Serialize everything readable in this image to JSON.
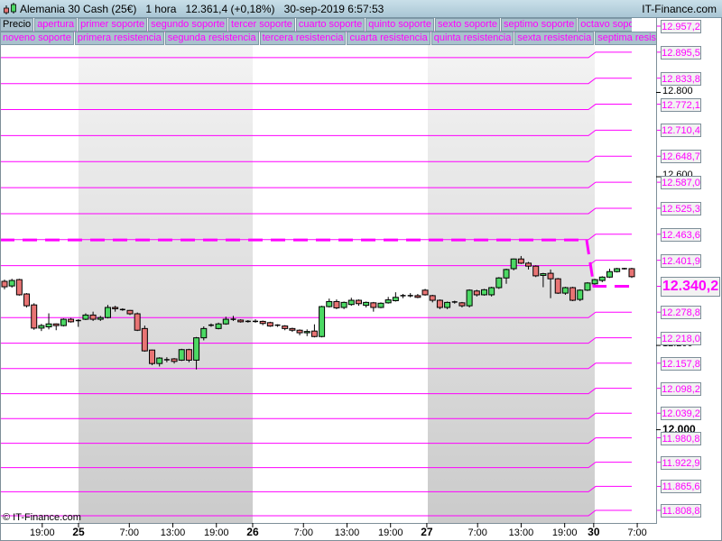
{
  "header": {
    "instrument": "Alemania 30 Cash (25€)",
    "timeframe": "1 hora",
    "price": "12.361,4 (+0,18%)",
    "datetime": "30-sep-2019 6:57:53",
    "brand": "IT-Finance.com"
  },
  "legend_row1": [
    "Precio",
    "apertura",
    "primer soporte",
    "segundo soporte",
    "tercer soporte",
    "cuarto soporte",
    "quinto soporte",
    "sexto soporte",
    "septimo soporte",
    "octavo soporte"
  ],
  "legend_row2": [
    "noveno soporte",
    "primera resistencia",
    "segunda resistencia",
    "tercera resistencia",
    "cuarta resistencia",
    "quinta resistencia",
    "sexta resistencia",
    "septima resistencia"
  ],
  "colors": {
    "level": "#ff00ff",
    "up": "#4cd964",
    "down": "#e87474",
    "axis": "#7e8f99"
  },
  "current_price": {
    "value": 12340.2,
    "label": "12.340,2",
    "previous": 12450
  },
  "levels": [
    {
      "value": 12957.2,
      "label": "12.957,2"
    },
    {
      "value": 12895.5,
      "label": "12.895,5"
    },
    {
      "value": 12833.8,
      "label": "12.833,8"
    },
    {
      "value": 12772.1,
      "label": "12.772,1"
    },
    {
      "value": 12710.4,
      "label": "12.710,4"
    },
    {
      "value": 12648.7,
      "label": "12.648,7"
    },
    {
      "value": 12587.0,
      "label": "12.587,0"
    },
    {
      "value": 12525.3,
      "label": "12.525,3"
    },
    {
      "value": 12463.6,
      "label": "12.463,6"
    },
    {
      "value": 12401.9,
      "label": "12.401,9"
    },
    {
      "value": 12278.8,
      "label": "12.278,8"
    },
    {
      "value": 12218.0,
      "label": "12.218,0"
    },
    {
      "value": 12157.8,
      "label": "12.157,8"
    },
    {
      "value": 12098.2,
      "label": "12.098,2"
    },
    {
      "value": 12039.2,
      "label": "12.039,2"
    },
    {
      "value": 11980.8,
      "label": "11.980,8"
    },
    {
      "value": 11922.9,
      "label": "11.922,9"
    },
    {
      "value": 11865.6,
      "label": "11.865,6"
    },
    {
      "value": 11808.8,
      "label": "11.808,8"
    }
  ],
  "y_axis_ticks": [
    {
      "value": 12800,
      "label": "12.800",
      "bold": false
    },
    {
      "value": 12600,
      "label": "12.600",
      "bold": false
    },
    {
      "value": 12200,
      "label": "12.200",
      "bold": false
    },
    {
      "value": 12000,
      "label": "12.000",
      "bold": true
    }
  ],
  "x_axis_ticks": [
    {
      "hour": -5,
      "label": "19:00",
      "bold": false
    },
    {
      "hour": 0,
      "label": "25",
      "bold": true
    },
    {
      "hour": 7,
      "label": "7:00",
      "bold": false
    },
    {
      "hour": 13,
      "label": "13:00",
      "bold": false
    },
    {
      "hour": 19,
      "label": "19:00",
      "bold": false
    },
    {
      "hour": 24,
      "label": "26",
      "bold": true
    },
    {
      "hour": 31,
      "label": "7:00",
      "bold": false
    },
    {
      "hour": 37,
      "label": "13:00",
      "bold": false
    },
    {
      "hour": 43,
      "label": "19:00",
      "bold": false
    },
    {
      "hour": 48,
      "label": "27",
      "bold": true
    },
    {
      "hour": 55,
      "label": "7:00",
      "bold": false
    },
    {
      "hour": 61,
      "label": "13:00",
      "bold": false
    },
    {
      "hour": 67,
      "label": "19:00",
      "bold": false
    },
    {
      "hour": 71,
      "label": "30",
      "bold": true
    },
    {
      "hour": 77,
      "label": "7:00",
      "bold": false
    }
  ],
  "copyright": "© IT-Finance.com",
  "candles": [
    [
      12352,
      12356,
      12333,
      12339
    ],
    [
      12341,
      12358,
      12337,
      12354
    ],
    [
      12356,
      12358,
      12318,
      12320
    ],
    [
      12322,
      12324,
      12290,
      12294
    ],
    [
      12296,
      12300,
      12237,
      12241
    ],
    [
      12241,
      12251,
      12234,
      12247
    ],
    [
      12244,
      12276,
      12238,
      12251
    ],
    [
      12251,
      12252,
      12236,
      12247
    ],
    [
      12247,
      12264,
      12245,
      12262
    ],
    [
      12262,
      12265,
      12254,
      12256
    ],
    [
      12259,
      12262,
      12244,
      12259
    ],
    [
      12262,
      12276,
      12260,
      12272
    ],
    [
      12272,
      12280,
      12258,
      12262
    ],
    [
      12262,
      12270,
      12258,
      12266
    ],
    [
      12266,
      12296,
      12264,
      12290
    ],
    [
      12290,
      12294,
      12280,
      12287
    ],
    [
      12285,
      12288,
      12282,
      12285
    ],
    [
      12283,
      12284,
      12272,
      12275
    ],
    [
      12275,
      12278,
      12234,
      12236
    ],
    [
      12240,
      12247,
      12185,
      12187
    ],
    [
      12189,
      12190,
      12153,
      12157
    ],
    [
      12157,
      12172,
      12150,
      12170
    ],
    [
      12166,
      12172,
      12160,
      12166
    ],
    [
      12168,
      12170,
      12157,
      12162
    ],
    [
      12165,
      12192,
      12163,
      12190
    ],
    [
      12190,
      12192,
      12160,
      12165
    ],
    [
      12165,
      12220,
      12143,
      12218
    ],
    [
      12218,
      12245,
      12212,
      12240
    ],
    [
      12248,
      12252,
      12244,
      12248
    ],
    [
      12240,
      12254,
      12238,
      12251
    ],
    [
      12251,
      12268,
      12249,
      12262
    ],
    [
      12262,
      12270,
      12258,
      12262
    ],
    [
      12260,
      12262,
      12254,
      12256
    ],
    [
      12257,
      12260,
      12254,
      12257
    ],
    [
      12257,
      12262,
      12254,
      12257
    ],
    [
      12257,
      12259,
      12248,
      12252
    ],
    [
      12254,
      12256,
      12244,
      12246
    ],
    [
      12248,
      12250,
      12244,
      12248
    ],
    [
      12246,
      12248,
      12236,
      12240
    ],
    [
      12240,
      12242,
      12232,
      12236
    ],
    [
      12236,
      12238,
      12224,
      12230
    ],
    [
      12230,
      12238,
      12222,
      12233
    ],
    [
      12234,
      12250,
      12219,
      12221
    ],
    [
      12221,
      12294,
      12219,
      12292
    ],
    [
      12292,
      12311,
      12290,
      12304
    ],
    [
      12304,
      12309,
      12286,
      12289
    ],
    [
      12290,
      12304,
      12286,
      12302
    ],
    [
      12297,
      12313,
      12294,
      12307
    ],
    [
      12307,
      12309,
      12294,
      12299
    ],
    [
      12295,
      12304,
      12290,
      12302
    ],
    [
      12301,
      12303,
      12280,
      12290
    ],
    [
      12290,
      12302,
      12288,
      12300
    ],
    [
      12301,
      12315,
      12299,
      12308
    ],
    [
      12306,
      12326,
      12304,
      12314
    ],
    [
      12316,
      12322,
      12312,
      12318
    ],
    [
      12318,
      12324,
      12314,
      12318
    ],
    [
      12318,
      12322,
      12312,
      12314
    ],
    [
      12331,
      12334,
      12318,
      12320
    ],
    [
      12318,
      12320,
      12302,
      12307
    ],
    [
      12307,
      12309,
      12286,
      12290
    ],
    [
      12290,
      12304,
      12286,
      12302
    ],
    [
      12303,
      12306,
      12299,
      12303
    ],
    [
      12301,
      12303,
      12290,
      12294
    ],
    [
      12294,
      12333,
      12290,
      12331
    ],
    [
      12329,
      12332,
      12316,
      12320
    ],
    [
      12320,
      12334,
      12318,
      12332
    ],
    [
      12320,
      12339,
      12316,
      12337
    ],
    [
      12337,
      12362,
      12334,
      12360
    ],
    [
      12360,
      12382,
      12346,
      12380
    ],
    [
      12382,
      12406,
      12378,
      12405
    ],
    [
      12405,
      12412,
      12393,
      12395
    ],
    [
      12395,
      12398,
      12380,
      12388
    ],
    [
      12388,
      12390,
      12362,
      12365
    ],
    [
      12366,
      12372,
      12338,
      12370
    ],
    [
      12371,
      12380,
      12312,
      12358
    ],
    [
      12358,
      12360,
      12322,
      12324
    ],
    [
      12324,
      12339,
      12320,
      12337
    ],
    [
      12337,
      12339,
      12305,
      12307
    ],
    [
      12309,
      12333,
      12305,
      12331
    ],
    [
      12331,
      12350,
      12329,
      12348
    ],
    [
      12346,
      12358,
      12344,
      12356
    ],
    [
      12354,
      12364,
      12350,
      12362
    ],
    [
      12362,
      12382,
      12360,
      12375
    ],
    [
      12375,
      12384,
      12373,
      12382
    ],
    [
      12382,
      12384,
      12380,
      12382
    ],
    [
      12382,
      12384,
      12360,
      12363
    ]
  ]
}
